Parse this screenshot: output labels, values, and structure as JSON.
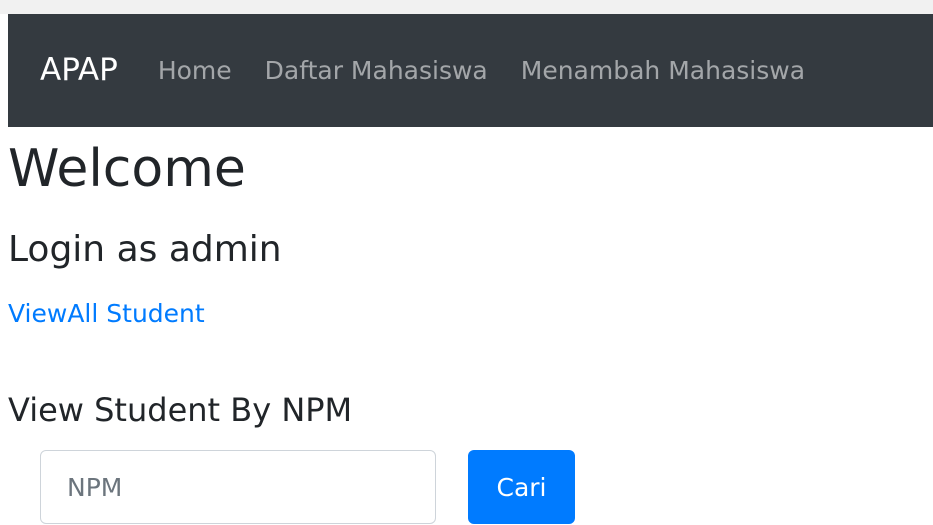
{
  "navbar": {
    "brand": "APAP",
    "links": [
      {
        "label": "Home"
      },
      {
        "label": "Daftar Mahasiswa"
      },
      {
        "label": "Menambah Mahasiswa"
      }
    ]
  },
  "main": {
    "title": "Welcome",
    "subtitle": "Login as admin",
    "view_all_link": "ViewAll Student",
    "search_heading": "View Student By NPM",
    "search": {
      "placeholder": "NPM",
      "value": "",
      "button_label": "Cari"
    }
  },
  "colors": {
    "navbar_bg": "#343a40",
    "primary": "#007bff",
    "link": "#007bff"
  }
}
